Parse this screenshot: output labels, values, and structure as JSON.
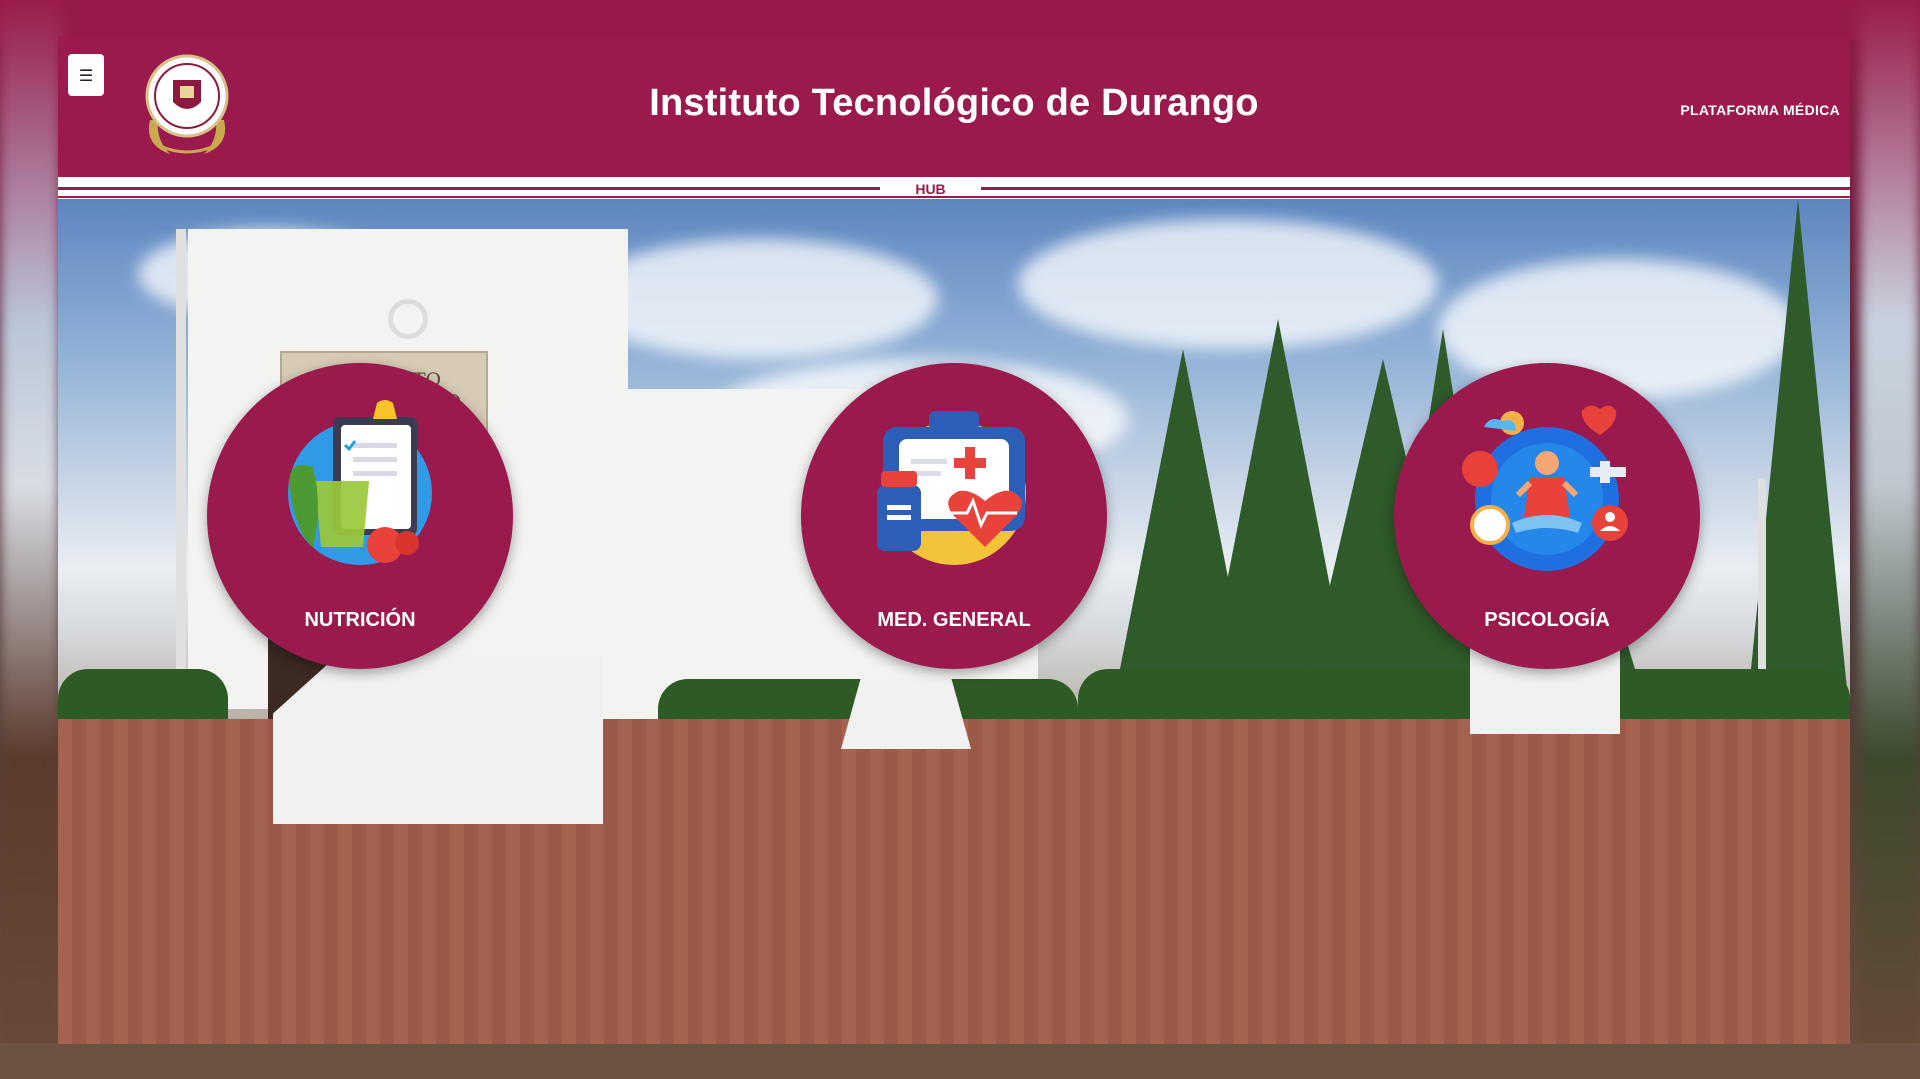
{
  "header": {
    "menu_icon": "☰",
    "title": "Instituto Tecnológico de Durango",
    "platform_label": "PLATAFORMA MÉDICA",
    "logo_icon": "institution-seal-logo"
  },
  "divider": {
    "label": "HUB"
  },
  "hero": {
    "building_sign": "INSTITUTO TECNOLOGICO"
  },
  "services": [
    {
      "label": "NUTRICIÓN",
      "icon": "nutrition-clipboard-icon"
    },
    {
      "label": "MED. GENERAL",
      "icon": "medical-kit-icon"
    },
    {
      "label": "PSICOLOGÍA",
      "icon": "wellbeing-meditation-icon"
    }
  ],
  "colors": {
    "brand": "#9b1a4e",
    "text_on_brand": "#ffffff"
  }
}
